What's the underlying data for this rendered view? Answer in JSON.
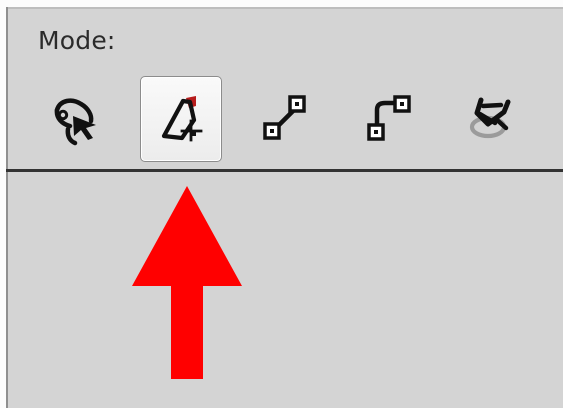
{
  "panel": {
    "mode_label": "Mode:",
    "tools": [
      {
        "name": "lasso-tool",
        "icon": "lasso-with-arrow-icon",
        "selected": false
      },
      {
        "name": "polygon-lasso-tool",
        "icon": "polygon-lasso-icon",
        "selected": true
      },
      {
        "name": "line-tool",
        "icon": "line-connector-icon",
        "selected": false
      },
      {
        "name": "bent-line-tool",
        "icon": "bent-connector-icon",
        "selected": false
      },
      {
        "name": "magnetic-lasso-tool",
        "icon": "magnet-lasso-icon",
        "selected": false
      }
    ],
    "colors": {
      "panel_bg": "#d4d4d4",
      "selected_bg": "#f3f3f3",
      "icon": "#222222",
      "arrow": "#ff0000"
    }
  }
}
